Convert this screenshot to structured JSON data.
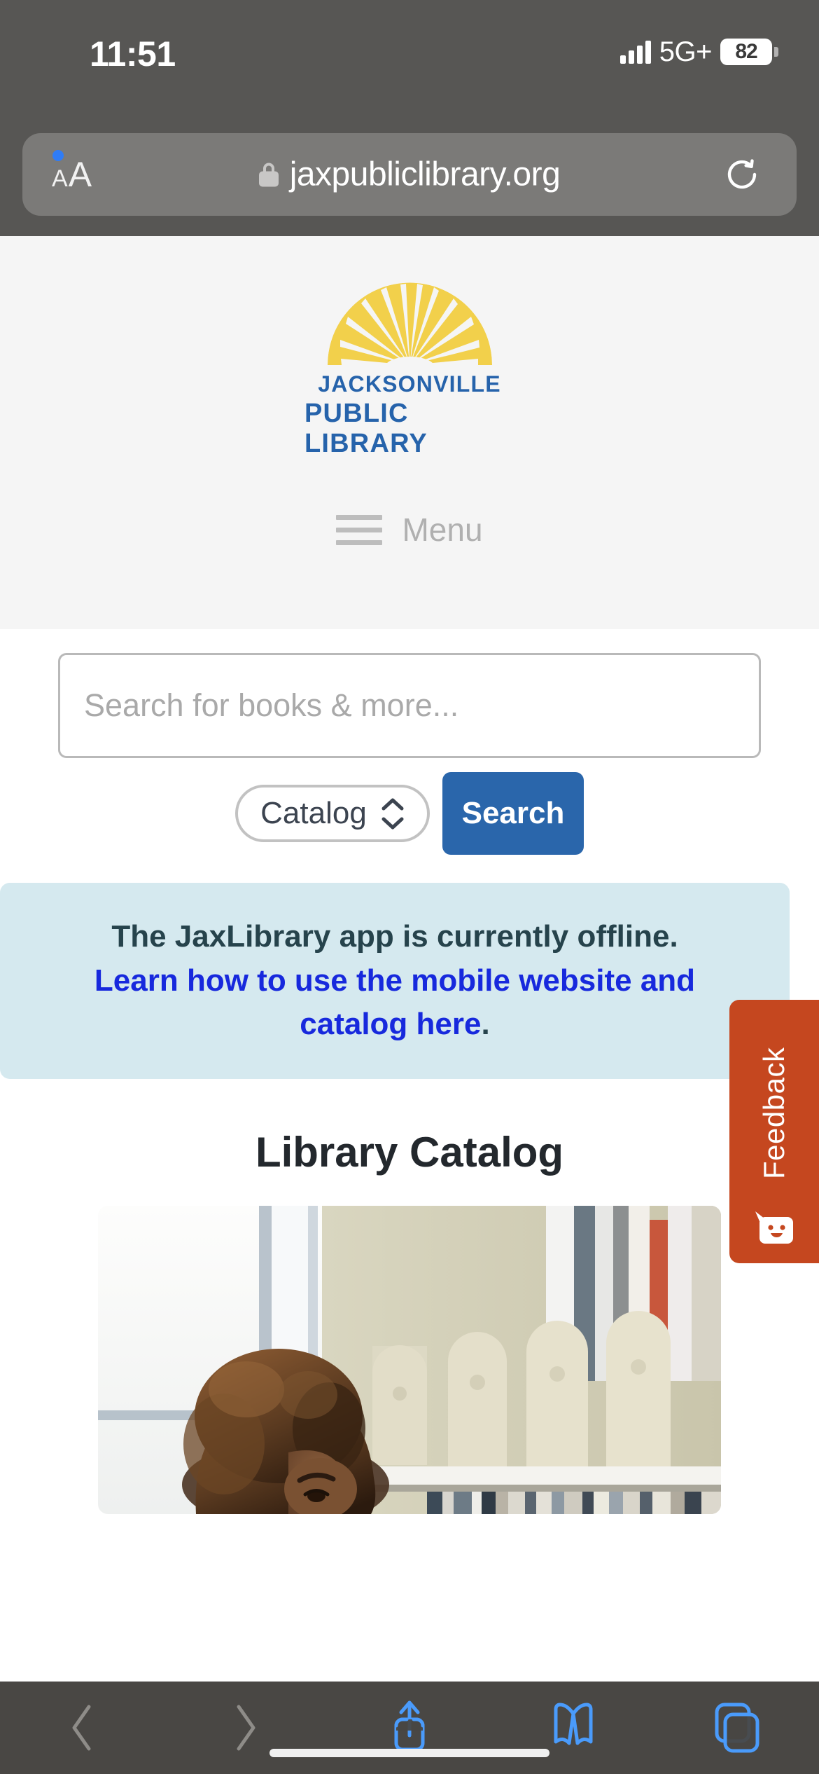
{
  "status_bar": {
    "time": "11:51",
    "network": "5G+",
    "battery_percent": "82",
    "signal_icon": "cellular-signal-icon",
    "battery_icon": "battery-icon"
  },
  "browser": {
    "text_size_label_small": "A",
    "text_size_label_large": "A",
    "text_size_icon": "text-size-aa-icon",
    "lock_icon": "lock-icon",
    "url": "jaxpubliclibrary.org",
    "reload_icon": "reload-icon",
    "toolbar": {
      "back_icon": "chevron-left-icon",
      "forward_icon": "chevron-right-icon",
      "share_icon": "share-icon",
      "bookmarks_icon": "book-icon",
      "tabs_icon": "tabs-icon"
    }
  },
  "site_header": {
    "logo_icon": "sunburst-logo-icon",
    "logo_line1": "JACKSONVILLE",
    "logo_line2": "PUBLIC  LIBRARY",
    "menu_icon": "hamburger-menu-icon",
    "menu_label": "Menu"
  },
  "search": {
    "placeholder": "Search for books & more...",
    "value": "",
    "scope_selected": "Catalog",
    "scope_chevron_icon": "chevron-up-down-icon",
    "submit_label": "Search"
  },
  "notice": {
    "line1": "The JaxLibrary app is currently offline.",
    "link_text": "Learn how to use the mobile website and catalog here",
    "period": "."
  },
  "feedback": {
    "label": "Feedback",
    "icon": "smiley-speech-bubble-icon"
  },
  "catalog": {
    "heading": "Library Catalog",
    "photo_alt": "library-patron-browsing-shelves-photo"
  },
  "colors": {
    "brand_blue": "#2663ab",
    "button_blue": "#2a66ab",
    "logo_yellow": "#efd košice"
  }
}
